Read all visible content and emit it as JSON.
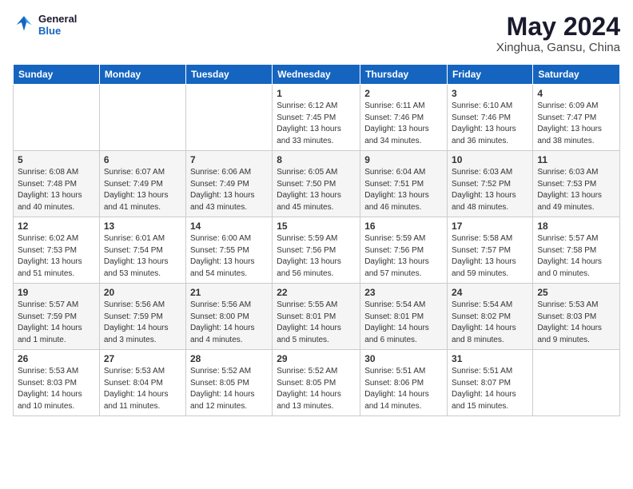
{
  "logo": {
    "part1": "General",
    "part2": "Blue"
  },
  "title": "May 2024",
  "subtitle": "Xinghua, Gansu, China",
  "days_of_week": [
    "Sunday",
    "Monday",
    "Tuesday",
    "Wednesday",
    "Thursday",
    "Friday",
    "Saturday"
  ],
  "weeks": [
    [
      {
        "day": "",
        "info": ""
      },
      {
        "day": "",
        "info": ""
      },
      {
        "day": "",
        "info": ""
      },
      {
        "day": "1",
        "info": "Sunrise: 6:12 AM\nSunset: 7:45 PM\nDaylight: 13 hours\nand 33 minutes."
      },
      {
        "day": "2",
        "info": "Sunrise: 6:11 AM\nSunset: 7:46 PM\nDaylight: 13 hours\nand 34 minutes."
      },
      {
        "day": "3",
        "info": "Sunrise: 6:10 AM\nSunset: 7:46 PM\nDaylight: 13 hours\nand 36 minutes."
      },
      {
        "day": "4",
        "info": "Sunrise: 6:09 AM\nSunset: 7:47 PM\nDaylight: 13 hours\nand 38 minutes."
      }
    ],
    [
      {
        "day": "5",
        "info": "Sunrise: 6:08 AM\nSunset: 7:48 PM\nDaylight: 13 hours\nand 40 minutes."
      },
      {
        "day": "6",
        "info": "Sunrise: 6:07 AM\nSunset: 7:49 PM\nDaylight: 13 hours\nand 41 minutes."
      },
      {
        "day": "7",
        "info": "Sunrise: 6:06 AM\nSunset: 7:49 PM\nDaylight: 13 hours\nand 43 minutes."
      },
      {
        "day": "8",
        "info": "Sunrise: 6:05 AM\nSunset: 7:50 PM\nDaylight: 13 hours\nand 45 minutes."
      },
      {
        "day": "9",
        "info": "Sunrise: 6:04 AM\nSunset: 7:51 PM\nDaylight: 13 hours\nand 46 minutes."
      },
      {
        "day": "10",
        "info": "Sunrise: 6:03 AM\nSunset: 7:52 PM\nDaylight: 13 hours\nand 48 minutes."
      },
      {
        "day": "11",
        "info": "Sunrise: 6:03 AM\nSunset: 7:53 PM\nDaylight: 13 hours\nand 49 minutes."
      }
    ],
    [
      {
        "day": "12",
        "info": "Sunrise: 6:02 AM\nSunset: 7:53 PM\nDaylight: 13 hours\nand 51 minutes."
      },
      {
        "day": "13",
        "info": "Sunrise: 6:01 AM\nSunset: 7:54 PM\nDaylight: 13 hours\nand 53 minutes."
      },
      {
        "day": "14",
        "info": "Sunrise: 6:00 AM\nSunset: 7:55 PM\nDaylight: 13 hours\nand 54 minutes."
      },
      {
        "day": "15",
        "info": "Sunrise: 5:59 AM\nSunset: 7:56 PM\nDaylight: 13 hours\nand 56 minutes."
      },
      {
        "day": "16",
        "info": "Sunrise: 5:59 AM\nSunset: 7:56 PM\nDaylight: 13 hours\nand 57 minutes."
      },
      {
        "day": "17",
        "info": "Sunrise: 5:58 AM\nSunset: 7:57 PM\nDaylight: 13 hours\nand 59 minutes."
      },
      {
        "day": "18",
        "info": "Sunrise: 5:57 AM\nSunset: 7:58 PM\nDaylight: 14 hours\nand 0 minutes."
      }
    ],
    [
      {
        "day": "19",
        "info": "Sunrise: 5:57 AM\nSunset: 7:59 PM\nDaylight: 14 hours\nand 1 minute."
      },
      {
        "day": "20",
        "info": "Sunrise: 5:56 AM\nSunset: 7:59 PM\nDaylight: 14 hours\nand 3 minutes."
      },
      {
        "day": "21",
        "info": "Sunrise: 5:56 AM\nSunset: 8:00 PM\nDaylight: 14 hours\nand 4 minutes."
      },
      {
        "day": "22",
        "info": "Sunrise: 5:55 AM\nSunset: 8:01 PM\nDaylight: 14 hours\nand 5 minutes."
      },
      {
        "day": "23",
        "info": "Sunrise: 5:54 AM\nSunset: 8:01 PM\nDaylight: 14 hours\nand 6 minutes."
      },
      {
        "day": "24",
        "info": "Sunrise: 5:54 AM\nSunset: 8:02 PM\nDaylight: 14 hours\nand 8 minutes."
      },
      {
        "day": "25",
        "info": "Sunrise: 5:53 AM\nSunset: 8:03 PM\nDaylight: 14 hours\nand 9 minutes."
      }
    ],
    [
      {
        "day": "26",
        "info": "Sunrise: 5:53 AM\nSunset: 8:03 PM\nDaylight: 14 hours\nand 10 minutes."
      },
      {
        "day": "27",
        "info": "Sunrise: 5:53 AM\nSunset: 8:04 PM\nDaylight: 14 hours\nand 11 minutes."
      },
      {
        "day": "28",
        "info": "Sunrise: 5:52 AM\nSunset: 8:05 PM\nDaylight: 14 hours\nand 12 minutes."
      },
      {
        "day": "29",
        "info": "Sunrise: 5:52 AM\nSunset: 8:05 PM\nDaylight: 14 hours\nand 13 minutes."
      },
      {
        "day": "30",
        "info": "Sunrise: 5:51 AM\nSunset: 8:06 PM\nDaylight: 14 hours\nand 14 minutes."
      },
      {
        "day": "31",
        "info": "Sunrise: 5:51 AM\nSunset: 8:07 PM\nDaylight: 14 hours\nand 15 minutes."
      },
      {
        "day": "",
        "info": ""
      }
    ]
  ]
}
